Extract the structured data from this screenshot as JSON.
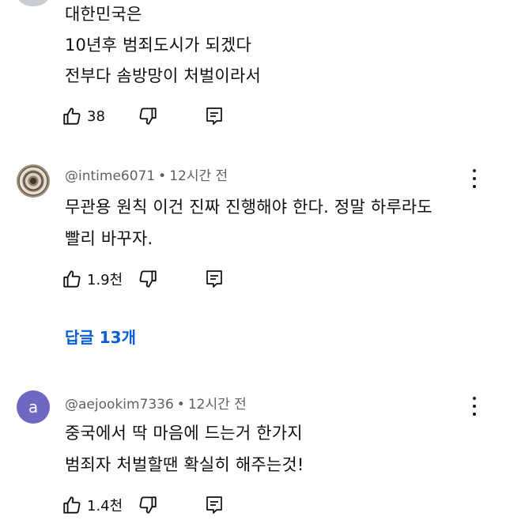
{
  "comments": [
    {
      "avatar": "partial-avatar",
      "lines": [
        "대한민국은",
        "10년후 범죄도시가 되겠다",
        "전부다 솜방망이 처벌이라서"
      ],
      "like_count": "38"
    },
    {
      "avatar": "dial-image-avatar",
      "author": "@intime6071",
      "separator": "•",
      "time": "12시간 전",
      "lines": [
        "무관용 원칙 이건 진짜 진행해야 한다. 정말 하루라도",
        "빨리 바꾸자."
      ],
      "like_count": "1.9천",
      "replies_label": "답글 13개"
    },
    {
      "avatar_letter": "a",
      "author": "@aejookim7336",
      "separator": "•",
      "time": "12시간 전",
      "lines": [
        "중국에서 딱 마음에 드는거 한가지",
        "범죄자 처벌할땐 확실히  해주는것!"
      ],
      "like_count": "1.4천"
    }
  ],
  "colors": {
    "link": "#065fd4",
    "avatar_a": "#6f68c2",
    "meta": "#606060"
  },
  "icons": [
    "thumb-up-icon",
    "thumb-down-icon",
    "reply-icon",
    "more-vert-icon"
  ]
}
